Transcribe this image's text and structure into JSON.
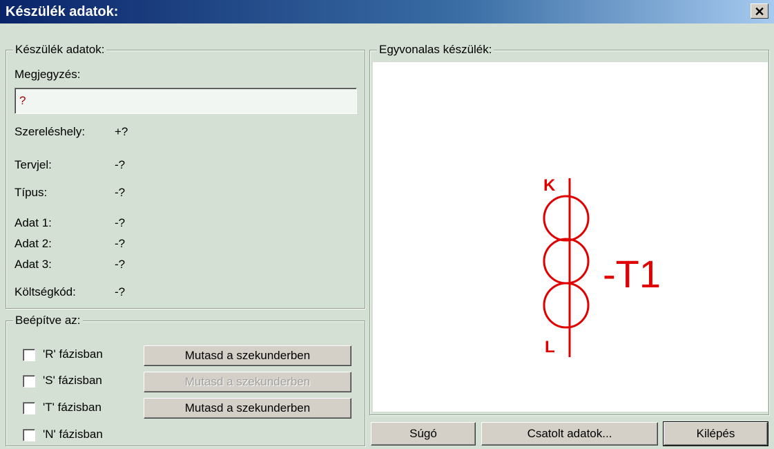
{
  "window": {
    "title": "Készülék adatok:",
    "close_label": "✕"
  },
  "device_data": {
    "legend": "Készülék adatok:",
    "note_label": "Megjegyzés:",
    "note_value": "?",
    "fields": [
      {
        "label": "Szereléshely:",
        "value": "+?"
      },
      {
        "label": "Tervjel:",
        "value": "-?"
      },
      {
        "label": "Típus:",
        "value": "-?"
      },
      {
        "label": "Adat 1:",
        "value": "-?"
      },
      {
        "label": "Adat 2:",
        "value": "-?"
      },
      {
        "label": "Adat 3:",
        "value": "-?"
      },
      {
        "label": "Költségkód:",
        "value": "-?"
      }
    ]
  },
  "installed": {
    "legend": "Beépítve az:",
    "phases": [
      {
        "label": "'R' fázisban",
        "checked": false,
        "button": "Mutasd a szekunderben",
        "enabled": true
      },
      {
        "label": "'S' fázisban",
        "checked": false,
        "button": "Mutasd a szekunderben",
        "enabled": false
      },
      {
        "label": "'T' fázisban",
        "checked": false,
        "button": "Mutasd a szekunderben",
        "enabled": true
      },
      {
        "label": "'N' fázisban",
        "checked": false
      }
    ]
  },
  "single_line": {
    "legend": "Egyvonalas készülék:",
    "symbol": {
      "top_label": "K",
      "bottom_label": "L",
      "designator": "-T1",
      "color": "#e00000"
    }
  },
  "footer": {
    "help": "Súgó",
    "attached": "Csatolt adatok...",
    "exit": "Kilépés"
  }
}
